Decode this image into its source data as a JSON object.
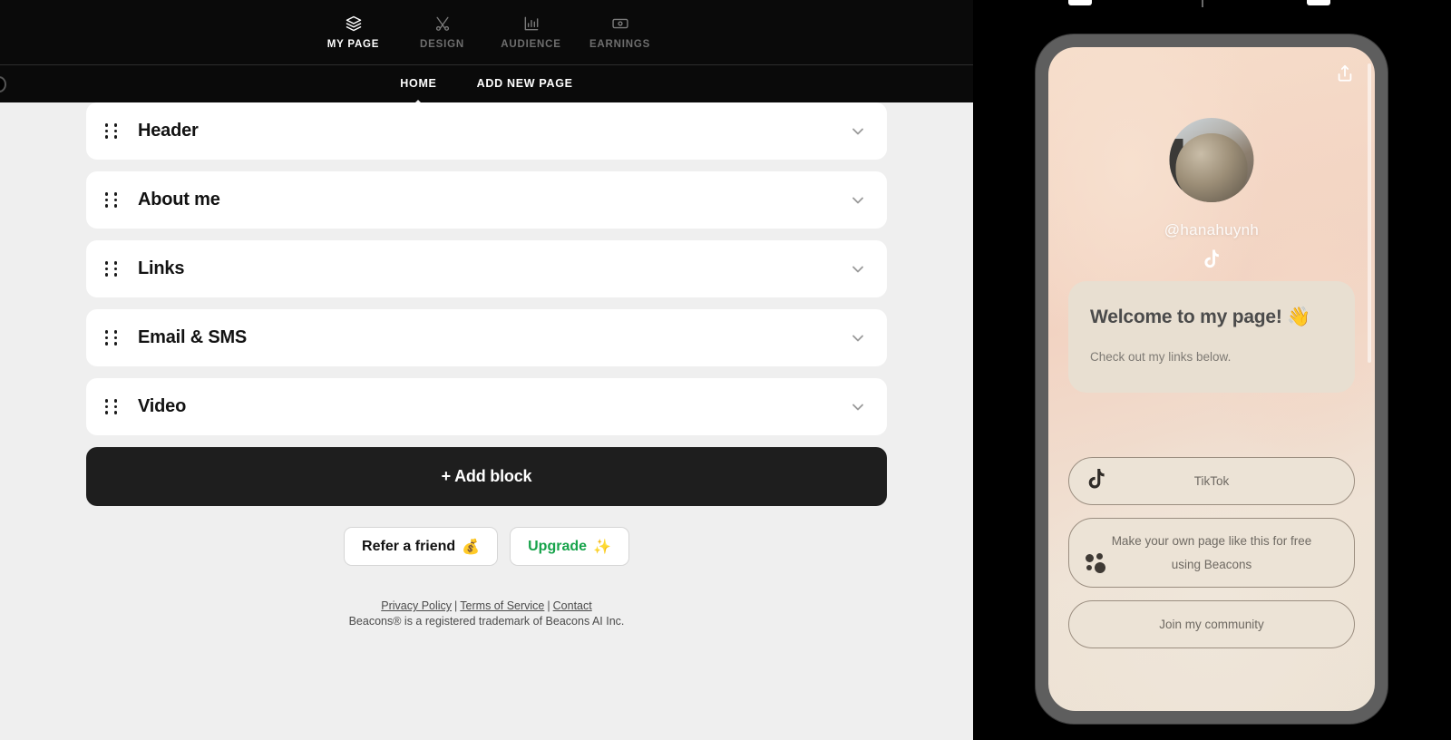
{
  "top_nav": {
    "items": [
      {
        "label": "MY PAGE",
        "icon": "layers-icon",
        "active": true
      },
      {
        "label": "DESIGN",
        "icon": "design-brush-icon",
        "active": false
      },
      {
        "label": "AUDIENCE",
        "icon": "bar-chart-icon",
        "active": false
      },
      {
        "label": "EARNINGS",
        "icon": "banknote-icon",
        "active": false
      }
    ]
  },
  "sub_nav": {
    "items": [
      {
        "label": "HOME",
        "active": true
      },
      {
        "label": "ADD NEW PAGE",
        "active": false
      }
    ]
  },
  "blocks": [
    {
      "title": "Header"
    },
    {
      "title": "About me"
    },
    {
      "title": "Links"
    },
    {
      "title": "Email & SMS"
    },
    {
      "title": "Video"
    }
  ],
  "add_block": {
    "label": "+ Add block"
  },
  "actions": {
    "refer": {
      "label": "Refer a friend",
      "emoji": "💰"
    },
    "upgrade": {
      "label": "Upgrade",
      "emoji": "✨",
      "color": "#16a34a"
    }
  },
  "footer": {
    "privacy": "Privacy Policy",
    "terms": "Terms of Service",
    "contact": "Contact",
    "separator": "|",
    "trademark": "Beacons® is a registered trademark of Beacons AI Inc."
  },
  "preview": {
    "handle": "@hanahuynh",
    "social": {
      "icon": "tiktok-icon"
    },
    "share": {
      "icon": "share-icon"
    },
    "card": {
      "heading": "Welcome to my page! 👋",
      "body": "Check out my links below."
    },
    "links": [
      {
        "label": "TikTok",
        "icon": "tiktok-icon"
      },
      {
        "label": "Make your own page like this for free using Beacons",
        "icon": "beacons-logo-icon"
      },
      {
        "label": "Join my community",
        "icon": "none"
      }
    ]
  },
  "colors": {
    "nav_bg": "#0a0a0a",
    "editor_bg": "#efefef",
    "card_bg": "#ffffff",
    "add_block_bg": "#1e1e1e",
    "upgrade_green": "#16a34a",
    "phone_bezel": "#5e5e5e",
    "preview_card": "#e8dfd1"
  }
}
